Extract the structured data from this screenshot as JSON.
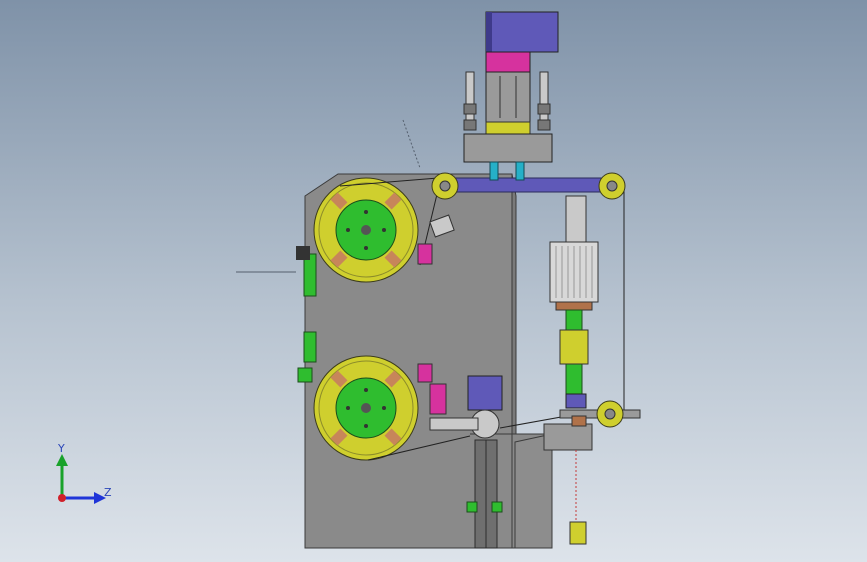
{
  "viewport": {
    "background_top": "#7f92a8",
    "background_bottom": "#dde3ea"
  },
  "triad": {
    "y_label": "Y",
    "z_label": "Z",
    "y_color": "#19a22a",
    "z_color": "#1f35d8",
    "x_color": "#d0202a"
  },
  "model": {
    "frame_color": "#8c8c8c",
    "reel_color": "#cfcf2e",
    "hub_color": "#2fbd2f",
    "motor_color": "#5f59b8",
    "accent_color": "#d6329e",
    "roller_color": "#cfcf2e"
  }
}
